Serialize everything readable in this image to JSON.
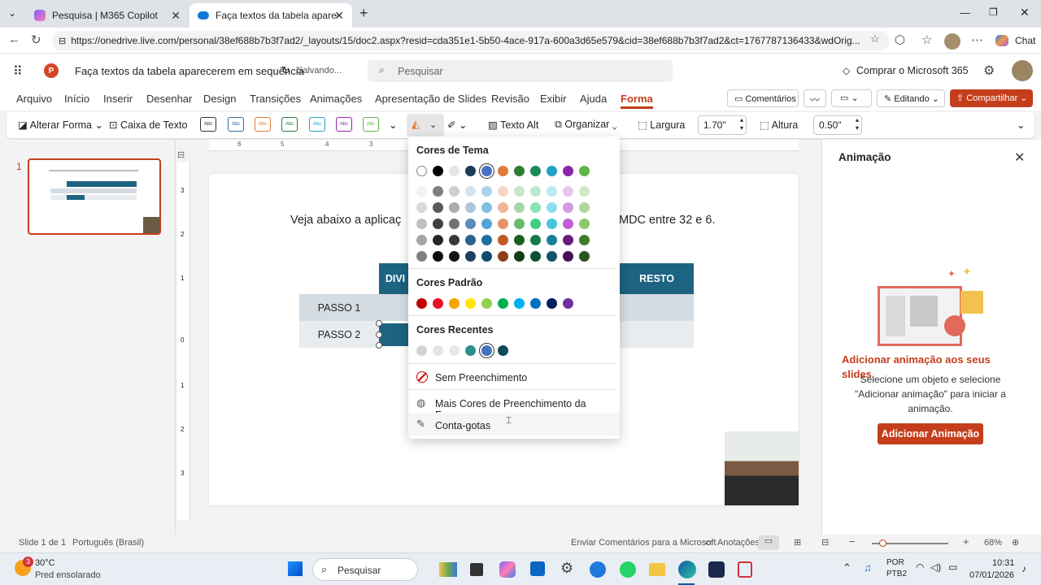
{
  "browser": {
    "tabs": [
      {
        "title": "Pesquisa | M365 Copilot"
      },
      {
        "title": "Faça textos da tabela aparecerem"
      }
    ],
    "url": "https://onedrive.live.com/personal/38ef688b7b3f7ad2/_layouts/15/doc2.aspx?resid=cda351e1-5b50-4ace-917a-600a3d65e579&cid=38ef688b7b3f7ad2&ct=1767787136433&wdOrig...",
    "chat_label": "Chat"
  },
  "app": {
    "doc_title": "Faça textos da tabela aparecerem em sequência",
    "saving": "Salvando...",
    "search_placeholder": "Pesquisar",
    "buy": "Comprar o Microsoft 365"
  },
  "menu": {
    "items": [
      "Arquivo",
      "Início",
      "Inserir",
      "Desenhar",
      "Design",
      "Transições",
      "Animações",
      "Apresentação de Slides",
      "Revisão",
      "Exibir",
      "Ajuda",
      "Forma"
    ],
    "comments": "Comentários",
    "editing": "Editando",
    "share": "Compartilhar"
  },
  "ribbon": {
    "change_shape": "Alterar Forma",
    "text_box": "Caixa de Texto",
    "style_label": "Abc",
    "alt_text": "Texto Alt",
    "arrange": "Organizar",
    "width_label": "Largura",
    "width_value": "1.70\"",
    "height_label": "Altura",
    "height_value": "0.50\""
  },
  "slide_panel": {
    "number": "1"
  },
  "slide": {
    "text_left": "Veja abaixo a aplicaç",
    "text_right": "MDC entre 32 e 6.",
    "header_col1": "DIVI",
    "header_rest": "RESTO",
    "row1": "PASSO 1",
    "row2": "PASSO 2"
  },
  "dropdown": {
    "theme_title": "Cores de Tema",
    "standard_title": "Cores Padrão",
    "recent_title": "Cores Recentes",
    "no_fill": "Sem Preenchimento",
    "more_colors": "Mais Cores de Preenchimento da Forma...",
    "eyedropper": "Conta-gotas",
    "theme_row": [
      "#ffffff",
      "#000000",
      "#e7e6e6",
      "#1f3b5a",
      "#4472c4",
      "#e07b39",
      "#2e7d32",
      "#1b8a5a",
      "#21a1c4",
      "#8e24aa",
      "#5fb547"
    ],
    "tints": [
      [
        "#f2f2f2",
        "#7f7f7f",
        "#d0cece",
        "#d6e3ef",
        "#a9d3eb",
        "#f6d7c6",
        "#c8e6c9",
        "#b9ead0",
        "#bde9f2",
        "#e7c4ee",
        "#cfe9c4"
      ],
      [
        "#d9d9d9",
        "#595959",
        "#aeabab",
        "#adc6de",
        "#7fc0e1",
        "#f0b597",
        "#a5d6a7",
        "#8ce0b5",
        "#8dddec",
        "#d49be0",
        "#afd89e"
      ],
      [
        "#bfbfbf",
        "#404040",
        "#767171",
        "#5d8bbd",
        "#4ea6d4",
        "#e89366",
        "#66bb6a",
        "#3ecf82",
        "#45c6de",
        "#c05fd1",
        "#8cc86a"
      ],
      [
        "#a6a6a6",
        "#262626",
        "#3a3838",
        "#2f5f8f",
        "#1d6f9f",
        "#c15a1f",
        "#1b5e20",
        "#137a4a",
        "#1a7f96",
        "#6a1b80",
        "#3e7d2e"
      ],
      [
        "#808080",
        "#0d0d0d",
        "#171616",
        "#1f3f5f",
        "#0f4c6f",
        "#8a3f15",
        "#0f3f13",
        "#0c5232",
        "#11566a",
        "#47125a",
        "#2a551f"
      ]
    ],
    "standard_row": [
      "#c00000",
      "#e81123",
      "#f4a300",
      "#ffe600",
      "#92d050",
      "#00b050",
      "#00b0f0",
      "#0070c0",
      "#002060",
      "#7030a0"
    ],
    "recent_row": [
      "#d0d4d7",
      "#e4e7ea",
      "#e7e9ec",
      "#2b8f8f",
      "#4472c4",
      "#0f4a5a"
    ]
  },
  "right_pane": {
    "title": "Animação",
    "heading": "Adicionar animação aos seus slides",
    "body": "Selecione um objeto e selecione \"Adicionar animação\" para iniciar a animação.",
    "button": "Adicionar Animação"
  },
  "status": {
    "slide": "Slide 1 de 1",
    "lang": "Português (Brasil)",
    "feedback": "Enviar Comentários para a Microsoft",
    "notes": "Anotações",
    "zoom": "68%"
  },
  "taskbar": {
    "temp": "30°C",
    "weather": "Pred ensolarado",
    "badge": "3",
    "search": "Pesquisar",
    "lang1": "POR",
    "lang2": "PTB2",
    "time": "10:31",
    "date": "07/01/2026"
  },
  "colors": {
    "accent": "#c43e1c",
    "table_header": "#1d6382",
    "table_row": "#d5dde3"
  }
}
